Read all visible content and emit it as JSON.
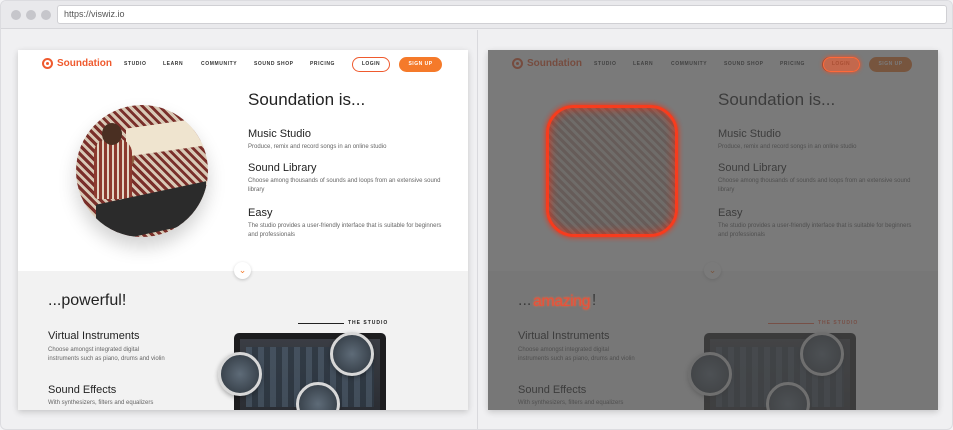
{
  "browser": {
    "url": "https://viswiz.io"
  },
  "site": {
    "logo_text": "Soundation",
    "nav": [
      "STUDIO",
      "LEARN",
      "COMMUNITY",
      "SOUND SHOP",
      "PRICING"
    ],
    "login_label": "LOGIN",
    "signup_label": "SIGN UP",
    "hero_title": "Soundation is...",
    "features": [
      {
        "title": "Music Studio",
        "desc": "Produce, remix and record songs in an online studio"
      },
      {
        "title": "Sound Library",
        "desc": "Choose among thousands of sounds and loops from an extensive sound library"
      },
      {
        "title": "Easy",
        "desc": "The studio provides a user-friendly interface that is suitable for beginners and professionals"
      }
    ],
    "section_title_baseline": "...powerful!",
    "studio_label": "THE STUDIO",
    "sections": [
      {
        "title": "Virtual Instruments",
        "desc": "Choose amongst integrated digital instruments such as piano, drums and violin"
      },
      {
        "title": "Sound Effects",
        "desc": "With synthesizers, filters and equalizers"
      }
    ]
  },
  "diff": {
    "section_title_prefix": "...",
    "changed_word": "amazing",
    "section_title_suffix": "!"
  },
  "colors": {
    "brand": "#ef5a2e",
    "signup_bg": "#f57a2a",
    "diff_highlight": "#ff3a1a"
  },
  "icons": {
    "chevron": "chevron-down-icon",
    "logo": "soundation-logo-icon"
  }
}
